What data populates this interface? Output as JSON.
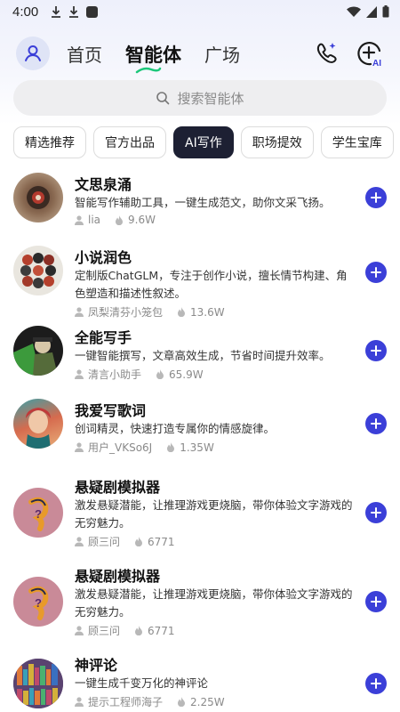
{
  "status_bar": {
    "time": "4:00"
  },
  "nav": {
    "tabs": [
      {
        "label": "首页"
      },
      {
        "label": "智能体"
      },
      {
        "label": "广场"
      }
    ],
    "accent_color": "#3b3fd8"
  },
  "search": {
    "placeholder": "搜索智能体"
  },
  "categories": [
    {
      "label": "精选推荐"
    },
    {
      "label": "官方出品"
    },
    {
      "label": "AI写作"
    },
    {
      "label": "职场提效"
    },
    {
      "label": "学生宝库"
    }
  ],
  "agents": [
    {
      "title": "文思泉涌",
      "desc": "智能写作辅助工具，一键生成范文，助你文采飞扬。",
      "author": "lia",
      "count": "9.6W"
    },
    {
      "title": "小说润色",
      "desc": "定制版ChatGLM，专注于创作小说，擅长情节构建、角色塑造和描述性叙述。",
      "author": "凤梨清芬小笼包",
      "count": "13.6W"
    },
    {
      "title": "全能写手",
      "desc": "一键智能撰写，文章高效生成，节省时间提升效率。",
      "author": "清言小助手",
      "count": "65.9W"
    },
    {
      "title": "我爱写歌词",
      "desc": "创词精灵，快速打造专属你的情感旋律。",
      "author": "用户_VKSo6J",
      "count": "1.35W"
    },
    {
      "title": "悬疑剧模拟器",
      "desc": "激发悬疑潜能，让推理游戏更烧脑，带你体验文字游戏的无穷魅力。",
      "author": "顾三问",
      "count": "6771"
    },
    {
      "title": "悬疑剧模拟器",
      "desc": "激发悬疑潜能，让推理游戏更烧脑，带你体验文字游戏的无穷魅力。",
      "author": "顾三问",
      "count": "6771"
    },
    {
      "title": "神评论",
      "desc": "一键生成千变万化的神评论",
      "author": "提示工程师海子",
      "count": "2.25W"
    }
  ]
}
